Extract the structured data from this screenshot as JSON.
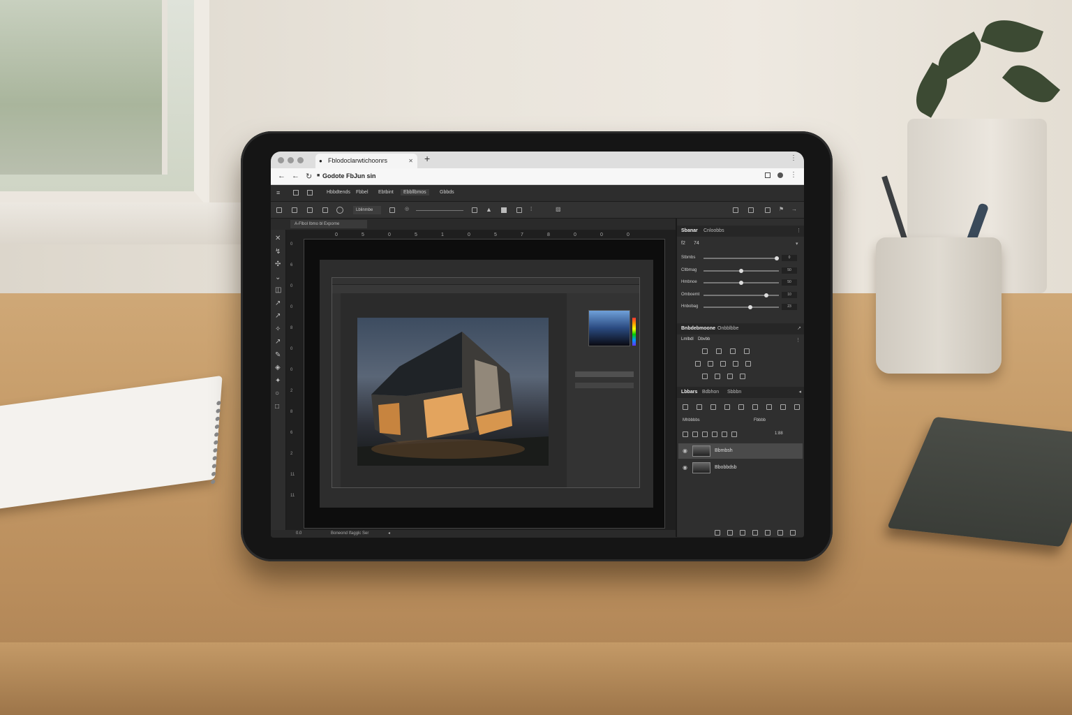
{
  "browser": {
    "tab_title": "Fblodoclarwtichoonrs",
    "address": "Godote FbJun sin",
    "new_tab": "+"
  },
  "menu": {
    "items": [
      "Hbbdtends",
      "Fbbel",
      "Ebtbint",
      "Ebbllbmos",
      "Gbbds"
    ],
    "active_index": 3
  },
  "options_bar": {
    "field_label": "Lblinmbe"
  },
  "document_tab": {
    "title": "A-Flbol Ibmo bl Exporne"
  },
  "rulers": {
    "top": [
      "0",
      "5",
      "0",
      "5",
      "1",
      "0",
      "5",
      "7",
      "8",
      "0",
      "0",
      "0"
    ],
    "left": [
      "0",
      "6",
      "0",
      "0",
      "8",
      "0",
      "0",
      "2",
      "8",
      "6",
      "2",
      "11",
      "11"
    ]
  },
  "status_bar": {
    "zoom": "0.0",
    "info": "Boneond Ifagglc Ser"
  },
  "panel_adjust": {
    "tabs": [
      "Sbanar",
      "Cnloobbs"
    ],
    "field_a": "f2",
    "field_b": "74",
    "sliders": [
      {
        "label": "Stbmbs",
        "value": 100,
        "display": "0"
      },
      {
        "label": "Cltbmag",
        "value": 50,
        "display": "50"
      },
      {
        "label": "Hmbnoe",
        "value": 50,
        "display": "50"
      },
      {
        "label": "Omboemt",
        "value": 85,
        "display": "10"
      },
      {
        "label": "Hnbobag",
        "value": 63,
        "display": "23"
      }
    ]
  },
  "panel_styles": {
    "tabs": [
      "Bnbdebmoone",
      "Onbblbbe"
    ],
    "subtabs": [
      "Lmlbdl",
      "Dbvbb"
    ]
  },
  "panel_layers": {
    "tabs": [
      "Lbbars",
      "Bdbhon",
      "Sbbbn"
    ],
    "blend_label": "Mhbbbbs",
    "opacity_label": "Fbbbb",
    "fill_value": "1:88",
    "layers": [
      {
        "name": "Bbmbsh",
        "selected": true
      },
      {
        "name": "Bbobbdsb",
        "selected": false
      }
    ]
  },
  "colors": {
    "app_bg": "#262626",
    "panel_bg": "#2f2f2f",
    "accent_light": "#f0b06a"
  }
}
